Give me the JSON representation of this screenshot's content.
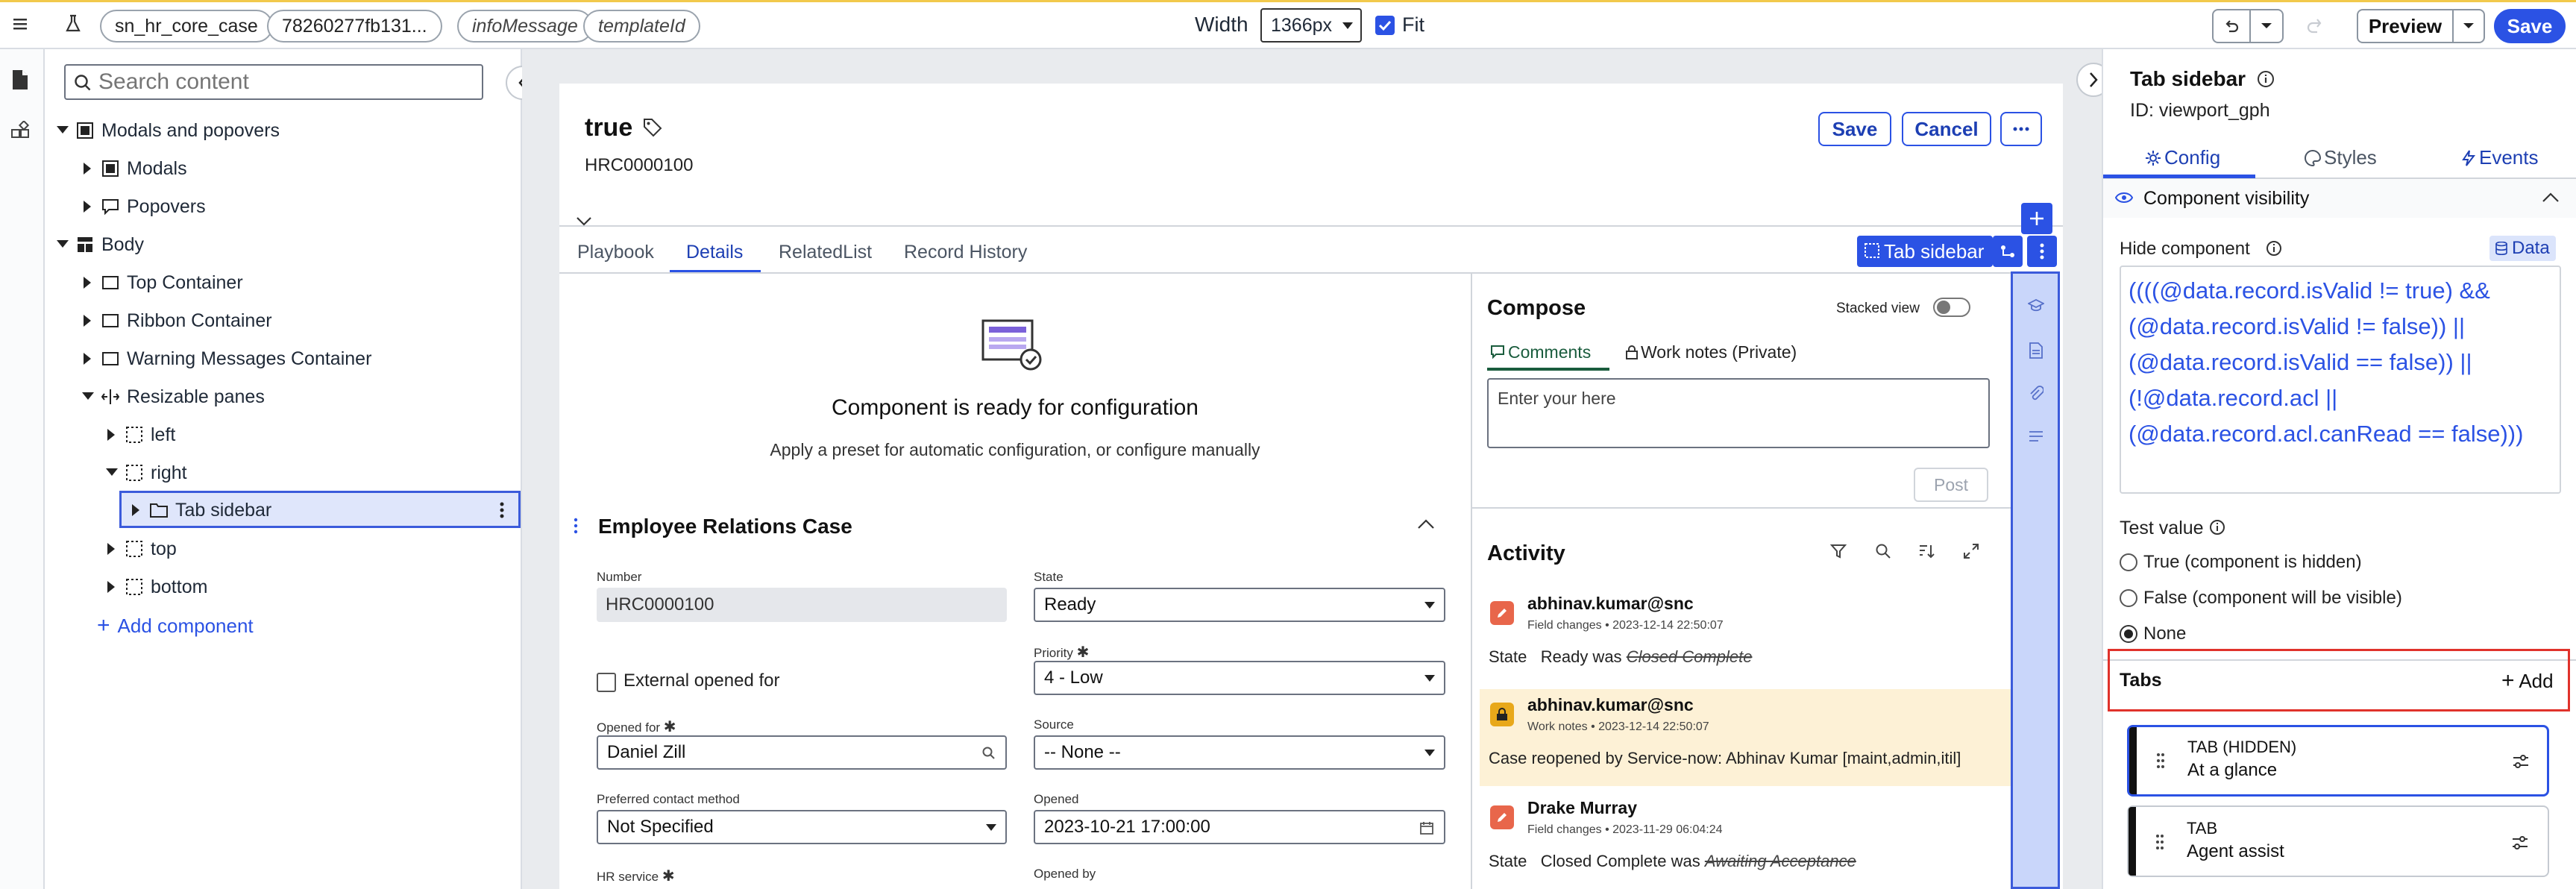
{
  "topbar": {
    "pills": [
      "sn_hr_core_case",
      "78260277fb131...",
      "infoMessage",
      "templateId"
    ],
    "width_label": "Width",
    "width_value": "1366px",
    "fit_label": "Fit",
    "preview_label": "Preview",
    "save_label": "Save"
  },
  "tree": {
    "search_placeholder": "Search content",
    "items": [
      {
        "label": "Modals and popovers"
      },
      {
        "label": "Modals"
      },
      {
        "label": "Popovers"
      },
      {
        "label": "Body"
      },
      {
        "label": "Top Container"
      },
      {
        "label": "Ribbon Container"
      },
      {
        "label": "Warning Messages Container"
      },
      {
        "label": "Resizable panes"
      },
      {
        "label": "left"
      },
      {
        "label": "right"
      },
      {
        "label": "Tab sidebar"
      },
      {
        "label": "top"
      },
      {
        "label": "bottom"
      }
    ],
    "add_component": "Add component"
  },
  "record": {
    "title": "true",
    "number": "HRC0000100",
    "save_label": "Save",
    "cancel_label": "Cancel",
    "tabs": [
      "Playbook",
      "Details",
      "RelatedList",
      "Record History"
    ],
    "tab_sidebar_chip": "Tab sidebar",
    "config_title": "Component is ready for configuration",
    "config_subtitle": "Apply a preset for automatic configuration, or configure manually",
    "form_title": "Employee Relations Case",
    "fields": {
      "number_label": "Number",
      "number_value": "HRC0000100",
      "state_label": "State",
      "state_value": "Ready",
      "external_label": "External opened for",
      "priority_label": "Priority",
      "priority_value": "4 - Low",
      "opened_for_label": "Opened for",
      "opened_for_value": "Daniel Zill",
      "source_label": "Source",
      "source_value": "-- None --",
      "contact_label": "Preferred contact method",
      "contact_value": "Not Specified",
      "opened_label": "Opened",
      "opened_value": "2023-10-21 17:00:00",
      "hr_service_label": "HR service",
      "opened_by_label": "Opened by"
    }
  },
  "compose": {
    "title": "Compose",
    "stacked_view": "Stacked view",
    "comments_tab": "Comments",
    "worknotes_tab": "Work notes (Private)",
    "placeholder": "Enter your  here",
    "post_label": "Post"
  },
  "activity": {
    "title": "Activity",
    "entries": [
      {
        "user": "abhinav.kumar@snc",
        "meta": "Field changes • 2023-12-14 22:50:07",
        "field": "State",
        "text": "Ready was",
        "old": "Closed Complete"
      },
      {
        "user": "abhinav.kumar@snc",
        "meta": "Work notes • 2023-12-14 22:50:07",
        "text": "Case reopened by Service-now: Abhinav Kumar [maint,admin,itil]"
      },
      {
        "user": "Drake Murray",
        "meta": "Field changes • 2023-11-29 06:04:24",
        "field": "State",
        "text": "Closed Complete was",
        "old": "Awaiting Acceptance"
      }
    ]
  },
  "rpanel": {
    "title": "Tab sidebar",
    "id_line": "ID: viewport_gph",
    "tabs": [
      "Config",
      "Styles",
      "Events"
    ],
    "visibility_section": "Component visibility",
    "hide_label": "Hide component",
    "data_chip": "Data",
    "code_lines": [
      "((((@data.record.isValid != true) &&",
      "(@data.record.isValid != false)) ||",
      "(@data.record.isValid == false)) ||",
      "(!@data.record.acl ||",
      "(@data.record.acl.canRead == false)))"
    ],
    "test_value_label": "Test value",
    "radios": [
      "True (component is hidden)",
      "False (component will be visible)",
      "None"
    ],
    "tabs_section": "Tabs",
    "add_label": "Add",
    "tab_cards": [
      {
        "kind": "TAB (HIDDEN)",
        "name": "At a glance"
      },
      {
        "kind": "TAB",
        "name": "Agent assist"
      }
    ]
  },
  "colors": {
    "accent": "#2b52e4",
    "highlight": "#e0322b",
    "worknote": "#fdf1d6"
  }
}
